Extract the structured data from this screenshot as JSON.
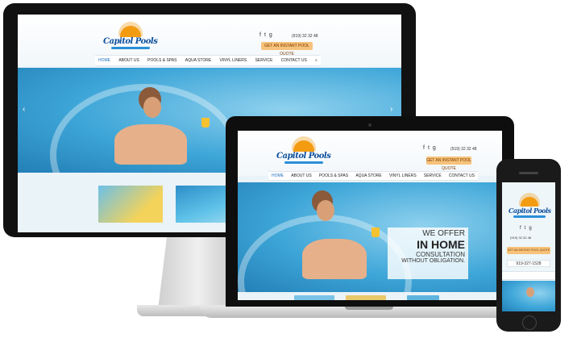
{
  "brand": {
    "name": "Capitol Pools",
    "sun_color": "#f39c12",
    "text_color": "#0d4f9c",
    "accent": "#1c6fbf"
  },
  "desktop": {
    "phone": "(919) 32 32 48",
    "quote_button": "GET AN INSTANT POOL QUOTE",
    "nav": [
      "HOME",
      "ABOUT US",
      "POOLS & SPAS",
      "AQUA STORE",
      "VINYL LINERS",
      "SERVICE",
      "CONTACT US"
    ],
    "icons": [
      "facebook-icon",
      "twitter-icon",
      "google-plus-icon",
      "search-icon"
    ]
  },
  "laptop": {
    "phone": "(919) 32 32 48",
    "quote_button": "GET AN INSTANT POOL QUOTE",
    "nav": [
      "HOME",
      "ABOUT US",
      "POOLS & SPAS",
      "AQUA STORE",
      "VINYL LINERS",
      "SERVICE",
      "CONTACT US"
    ],
    "overlay": {
      "line1": "WE OFFER",
      "line2": "IN HOME",
      "line3": "CONSULTATION",
      "line4": "WITHOUT OBLIGATION."
    }
  },
  "mobile": {
    "phone": "(919) 32 32 48",
    "quote_button": "GET AN INSTANT POOL QUOTE",
    "call_text": "919-327-1528"
  }
}
